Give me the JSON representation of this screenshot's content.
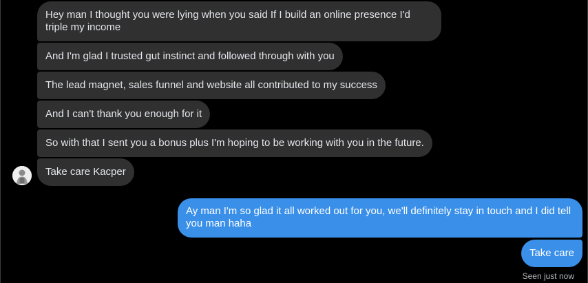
{
  "conversation": {
    "incoming": [
      {
        "text": "Hey man I thought you were lying when you said If I build an online presence I'd triple my income"
      },
      {
        "text": "And I'm glad I trusted gut instinct and followed through with you"
      },
      {
        "text": "The lead magnet, sales funnel and website all contributed to my success"
      },
      {
        "text": "And I can't thank you enough for it"
      },
      {
        "text": "So with that I sent you a bonus plus I'm hoping to be working with you in the future."
      },
      {
        "text": "Take care Kacper"
      }
    ],
    "outgoing": [
      {
        "text": "Ay man I'm so glad it all worked out for you, we'll definitely stay in touch and I did tell you man haha"
      },
      {
        "text": "Take care"
      }
    ],
    "status": "Seen just now"
  },
  "colors": {
    "background": "#000000",
    "incoming_bubble": "#303030",
    "outgoing_bubble": "#3a8fe8"
  }
}
